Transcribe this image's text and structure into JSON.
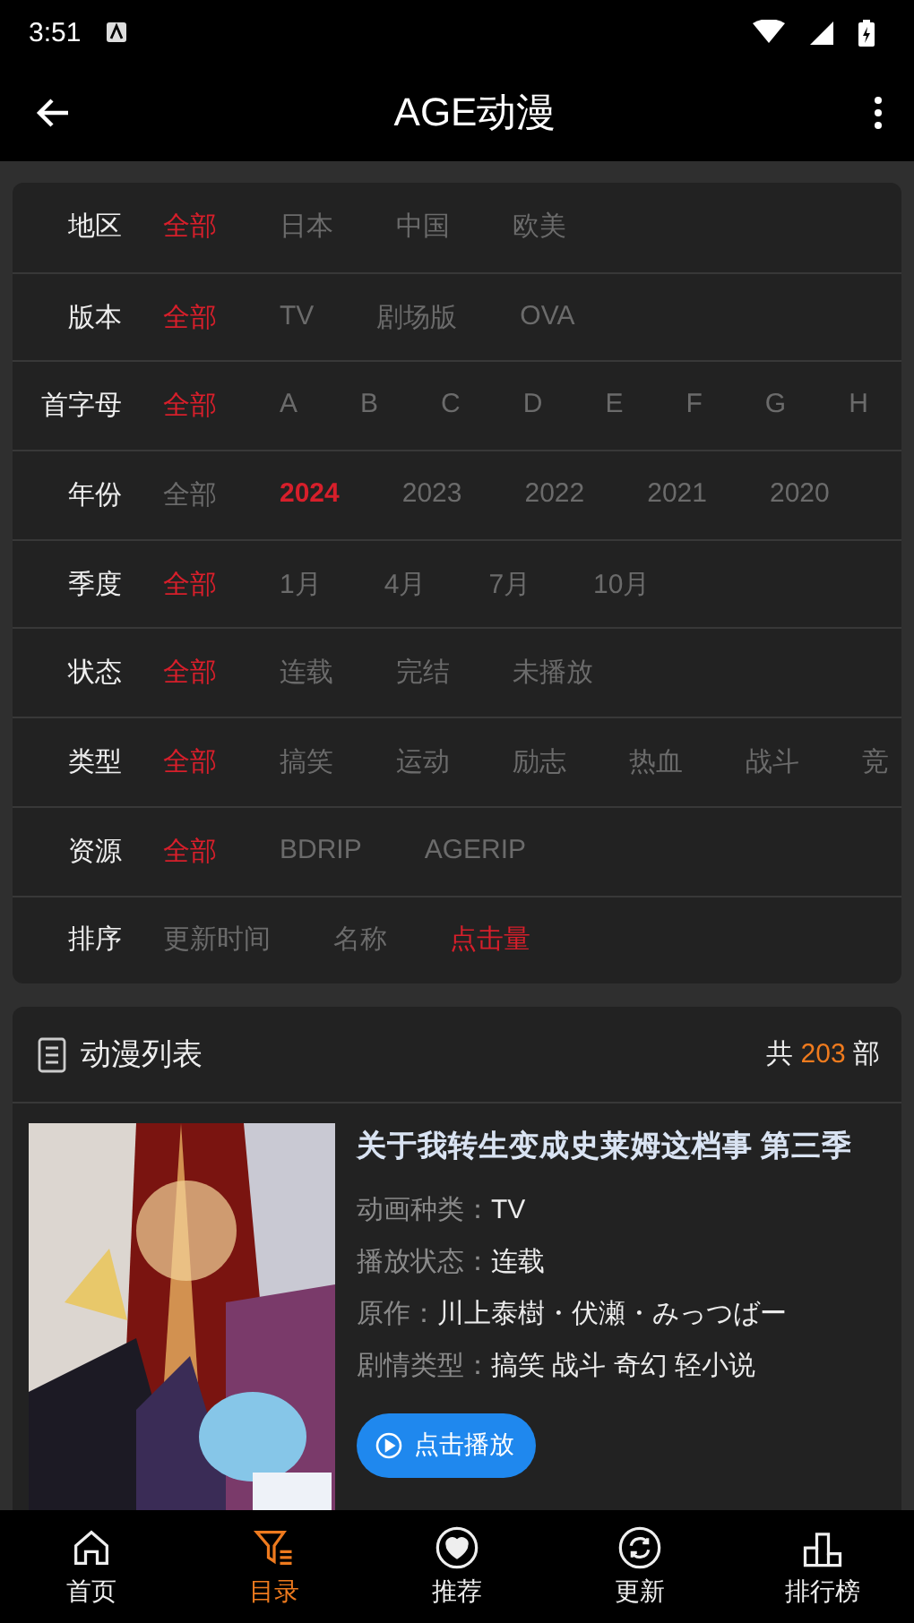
{
  "status_bar": {
    "time": "3:51"
  },
  "app_bar": {
    "title": "AGE动漫"
  },
  "filters": [
    {
      "label": "地区",
      "options": [
        {
          "text": "全部",
          "selected": true
        },
        {
          "text": "日本",
          "selected": false
        },
        {
          "text": "中国",
          "selected": false
        },
        {
          "text": "欧美",
          "selected": false
        }
      ]
    },
    {
      "label": "版本",
      "options": [
        {
          "text": "全部",
          "selected": true
        },
        {
          "text": "TV",
          "selected": false
        },
        {
          "text": "剧场版",
          "selected": false
        },
        {
          "text": "OVA",
          "selected": false
        }
      ]
    },
    {
      "label": "首字母",
      "options": [
        {
          "text": "全部",
          "selected": true
        },
        {
          "text": "A",
          "selected": false
        },
        {
          "text": "B",
          "selected": false
        },
        {
          "text": "C",
          "selected": false
        },
        {
          "text": "D",
          "selected": false
        },
        {
          "text": "E",
          "selected": false
        },
        {
          "text": "F",
          "selected": false
        },
        {
          "text": "G",
          "selected": false
        },
        {
          "text": "H",
          "selected": false
        }
      ]
    },
    {
      "label": "年份",
      "options": [
        {
          "text": "全部",
          "selected": false
        },
        {
          "text": "2024",
          "selected": true
        },
        {
          "text": "2023",
          "selected": false
        },
        {
          "text": "2022",
          "selected": false
        },
        {
          "text": "2021",
          "selected": false
        },
        {
          "text": "2020",
          "selected": false
        }
      ]
    },
    {
      "label": "季度",
      "options": [
        {
          "text": "全部",
          "selected": true
        },
        {
          "text": "1月",
          "selected": false
        },
        {
          "text": "4月",
          "selected": false
        },
        {
          "text": "7月",
          "selected": false
        },
        {
          "text": "10月",
          "selected": false
        }
      ]
    },
    {
      "label": "状态",
      "options": [
        {
          "text": "全部",
          "selected": true
        },
        {
          "text": "连载",
          "selected": false
        },
        {
          "text": "完结",
          "selected": false
        },
        {
          "text": "未播放",
          "selected": false
        }
      ]
    },
    {
      "label": "类型",
      "options": [
        {
          "text": "全部",
          "selected": true
        },
        {
          "text": "搞笑",
          "selected": false
        },
        {
          "text": "运动",
          "selected": false
        },
        {
          "text": "励志",
          "selected": false
        },
        {
          "text": "热血",
          "selected": false
        },
        {
          "text": "战斗",
          "selected": false
        },
        {
          "text": "竞",
          "selected": false
        }
      ]
    },
    {
      "label": "资源",
      "options": [
        {
          "text": "全部",
          "selected": true
        },
        {
          "text": "BDRIP",
          "selected": false
        },
        {
          "text": "AGERIP",
          "selected": false
        }
      ]
    },
    {
      "label": "排序",
      "options": [
        {
          "text": "更新时间",
          "selected": false
        },
        {
          "text": "名称",
          "selected": false
        },
        {
          "text": "点击量",
          "selected": true
        }
      ]
    }
  ],
  "anime_list": {
    "title": "动漫列表",
    "count_prefix": "共",
    "count": "203",
    "count_suffix": "部",
    "items": [
      {
        "poster": {
          "kind": "picture"
        },
        "title": "关于我转生变成史莱姆这档事 第三季",
        "fields": [
          {
            "label": "动画种类：",
            "value": "TV"
          },
          {
            "label": "播放状态：",
            "value": "连载"
          },
          {
            "label": "原作：",
            "value": "川上泰樹・伏瀬・みっつばー"
          },
          {
            "label": "剧情类型：",
            "value": "搞笑 战斗 奇幻 轻小说"
          }
        ],
        "play_button": "点击播放"
      }
    ]
  },
  "bottom_nav": [
    {
      "label": "首页",
      "selected": false
    },
    {
      "label": "目录",
      "selected": true
    },
    {
      "label": "推荐",
      "selected": false
    },
    {
      "label": "更新",
      "selected": false
    },
    {
      "label": "排行榜",
      "selected": false
    }
  ]
}
